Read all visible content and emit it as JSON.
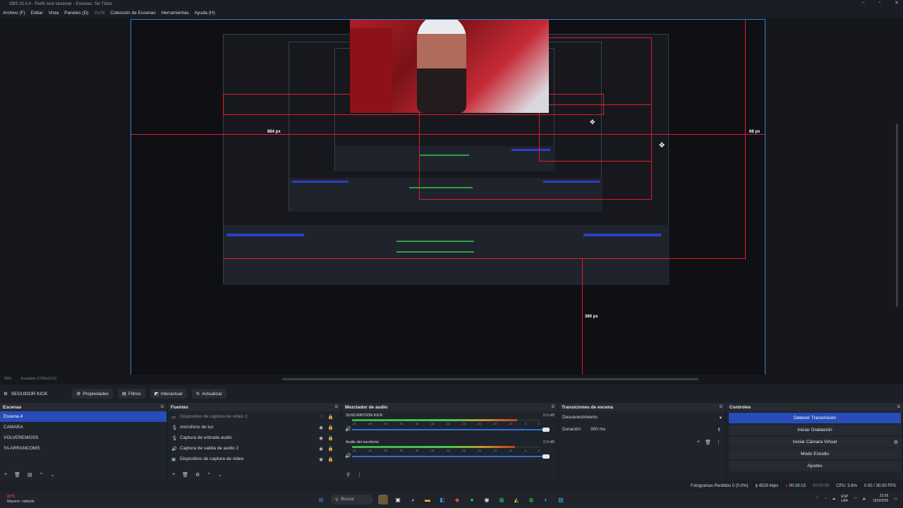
{
  "titlebar": {
    "title": "OBS 32.0.4 - Perfil: kick streamer - Escenas: Sin Título"
  },
  "menu": [
    "Archivo (F)",
    "Editar",
    "Vista",
    "Paneles (D)",
    "Perfil",
    "Colección de Escenas",
    "Herramientas",
    "Ayuda (H)"
  ],
  "preview": {
    "dims": [
      "864 px",
      "68 px",
      "360 px"
    ],
    "zoom": "93%",
    "scaled": "Escalado (1799x1012)"
  },
  "scenebar": {
    "current": "SEGUIDOR KICK",
    "buttons": [
      "Propiedades",
      "Filtros",
      "Interactuar",
      "Actualizar"
    ]
  },
  "scenes": {
    "title": "Escenas",
    "items": [
      "Escena 4",
      "CAMARA",
      "VOLVEREMOSS",
      "YA ARRANCOMS"
    ],
    "selected": 0
  },
  "sources": {
    "title": "Fuentes",
    "items": [
      {
        "icon": "monitor-icon",
        "label": "Dispositivo de captura de video 2",
        "dim": true
      },
      {
        "icon": "mic-icon",
        "label": "microfono de luz",
        "dim": false
      },
      {
        "icon": "mic-icon",
        "label": "Captura de entrada audio",
        "dim": false
      },
      {
        "icon": "speaker-icon",
        "label": "Captura de salida de audio 2",
        "dim": false
      },
      {
        "icon": "camera-icon",
        "label": "Dispositivo de captura de video",
        "dim": false
      }
    ]
  },
  "mixer": {
    "title": "Mezclador de audio",
    "channels": [
      {
        "name": "SUSCRIPCION KICK",
        "db": "0.0 dB",
        "level": 0.88
      },
      {
        "name": "Audio del escritorio",
        "db": "0.0 dB",
        "level": 0.87
      }
    ],
    "ticks": [
      "-60",
      "-55",
      "-50",
      "-45",
      "-40",
      "-35",
      "-30",
      "-25",
      "-20",
      "-15",
      "-10",
      "-5",
      "0"
    ]
  },
  "transitions": {
    "title": "Transiciones de escena",
    "selected": "Desvanecimiento",
    "duration_label": "Duración",
    "duration_value": "300 ms"
  },
  "controls": {
    "title": "Controles",
    "buttons": [
      "Detener Transmisión",
      "Iniciar Grabación",
      "Iniciar Cámara Virtual",
      "Modo Estudio",
      "Ajustes"
    ]
  },
  "status": {
    "dropped": "Fotogramas Perdidos 0 (0.0%)",
    "bitrate": "4529 kbps",
    "live": "00:26:13",
    "rec": "00:00:00",
    "cpu": "CPU: 3.6%",
    "fps": "0.00 / 30.00 FPS"
  },
  "taskbar": {
    "temp": "21°C",
    "weather": "Mayorm. nublado",
    "search": "Buscar",
    "lang": "ESP\nLAA",
    "time": "23:26",
    "date": "16/3/2026"
  },
  "colors": {
    "accent": "#284cb8",
    "guide": "#e21b2d",
    "meter": "#3fb14a"
  }
}
